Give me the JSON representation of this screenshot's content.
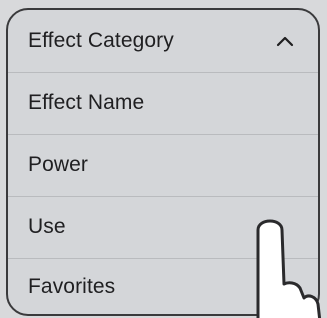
{
  "dropdown": {
    "header_label": "Effect Category",
    "expanded_icon": "chevron-up-icon",
    "options": [
      {
        "label": "Effect Name"
      },
      {
        "label": "Power"
      },
      {
        "label": "Use"
      },
      {
        "label": "Favorites"
      }
    ]
  },
  "pointer": {
    "icon": "pointing-hand-icon"
  },
  "colors": {
    "background": "#d8d9db",
    "panel": "#d4d6d9",
    "border": "#3a3a3c",
    "divider": "#b9bbbe",
    "text": "#1f1f21",
    "hand_fill": "#ffffff"
  }
}
